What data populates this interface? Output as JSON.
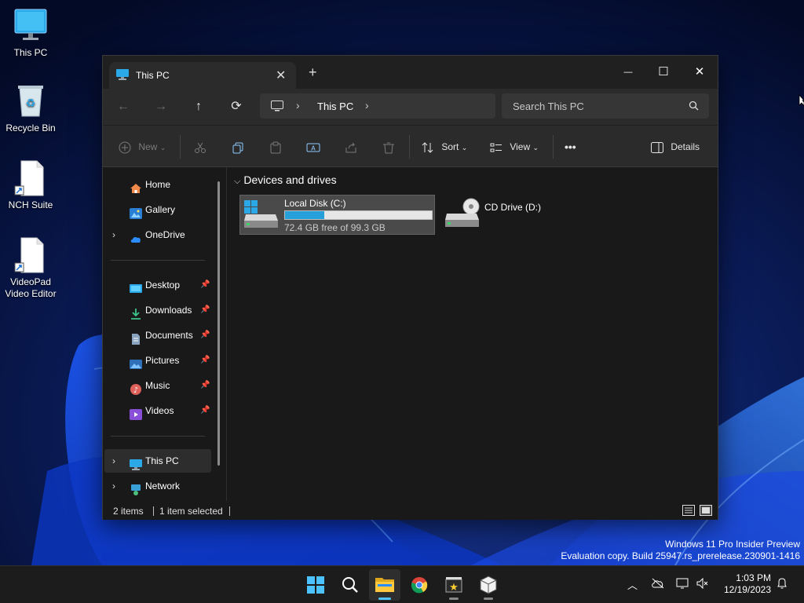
{
  "desktop": {
    "icons": [
      {
        "label": "This PC"
      },
      {
        "label": "Recycle Bin"
      },
      {
        "label": "NCH Suite"
      },
      {
        "label": "VideoPad Video Editor"
      }
    ]
  },
  "explorer": {
    "tab_title": "This PC",
    "tab_close": "✕",
    "new_tab": "+",
    "window_controls": {
      "minimize": "—",
      "maximize": "☐",
      "close": "✕"
    },
    "nav": {
      "back": "←",
      "forward": "→",
      "up": "↑",
      "refresh": "⟳"
    },
    "address": {
      "chevron": "›",
      "crumb": "This PC"
    },
    "search": {
      "placeholder": "Search This PC"
    },
    "commands": {
      "new": "New",
      "sort": "Sort",
      "view": "View",
      "more": "•••",
      "details": "Details"
    },
    "navpane": {
      "quick": [
        {
          "label": "Home",
          "icon": "home-icon"
        },
        {
          "label": "Gallery",
          "icon": "gallery-icon"
        },
        {
          "label": "OneDrive",
          "icon": "cloud-icon"
        }
      ],
      "pinned": [
        {
          "label": "Desktop",
          "icon": "desktop-icon"
        },
        {
          "label": "Downloads",
          "icon": "download-icon"
        },
        {
          "label": "Documents",
          "icon": "document-icon"
        },
        {
          "label": "Pictures",
          "icon": "picture-icon"
        },
        {
          "label": "Music",
          "icon": "music-icon"
        },
        {
          "label": "Videos",
          "icon": "video-icon"
        }
      ],
      "locations": [
        {
          "label": "This PC",
          "icon": "pc-icon",
          "selected": true
        },
        {
          "label": "Network",
          "icon": "network-icon"
        }
      ]
    },
    "content": {
      "group_title": "Devices and drives",
      "drives": [
        {
          "name": "Local Disk (C:)",
          "free_text": "72.4 GB free of 99.3 GB",
          "used_fraction": 0.27
        },
        {
          "name": "CD Drive (D:)"
        }
      ]
    },
    "status": {
      "items": "2 items",
      "selected": "1 item selected"
    }
  },
  "watermark": {
    "line1": "Windows 11 Pro Insider Preview",
    "line2": "Evaluation copy. Build 25947.rs_prerelease.230901-1416"
  },
  "taskbar": {
    "time": "1:03 PM",
    "date": "12/19/2023",
    "accent": "#4cc2ff"
  }
}
